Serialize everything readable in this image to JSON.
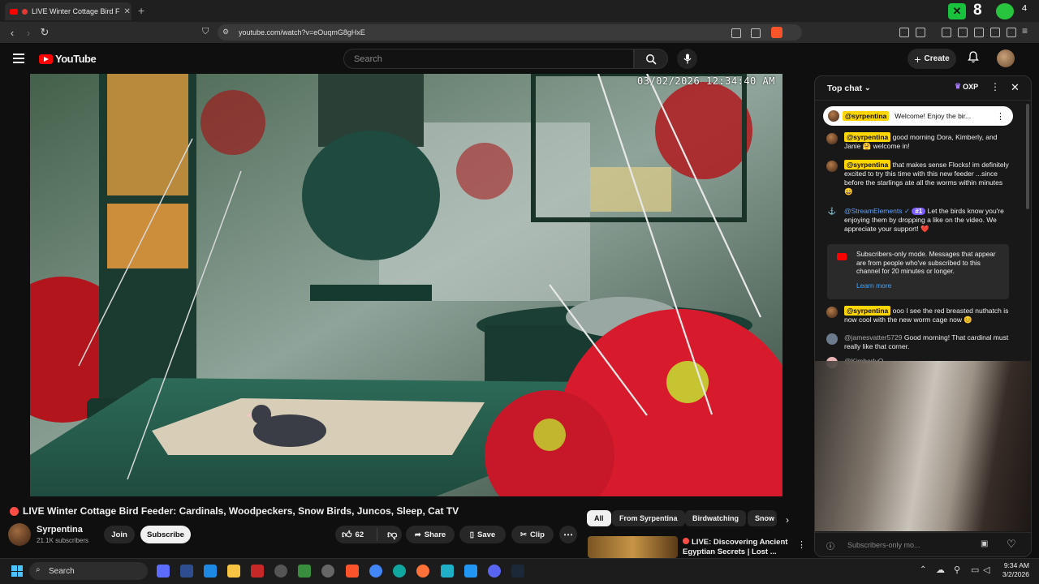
{
  "browser": {
    "tab_title": "LIVE Winter Cottage Bird F",
    "url": "youtube.com/watch?v=eOuqmG8gHxE",
    "ext_badge_count": "8"
  },
  "youtube": {
    "logo_text": "YouTube",
    "search_placeholder": "Search",
    "create_label": "Create"
  },
  "video": {
    "overlay_timestamp": "03/02/2026 12:34:40 AM",
    "title": "LIVE Winter Cottage Bird Feeder: Cardinals, Woodpeckers, Snow Birds, Juncos, Sleep, Cat TV",
    "channel_name": "Syrpentina",
    "subscribers": "21.1K subscribers",
    "join_label": "Join",
    "subscribe_label": "Subscribe",
    "like_count": "62",
    "share_label": "Share",
    "save_label": "Save",
    "clip_label": "Clip"
  },
  "chips": [
    "All",
    "From Syrpentina",
    "Birdwatching",
    "Snow"
  ],
  "related": {
    "title": "LIVE: Discovering Ancient Egyptian Secrets | Lost ..."
  },
  "chat": {
    "header": "Top chat",
    "oxp": "OXP",
    "pinned": {
      "author": "@syrpentina",
      "text": "Welcome! Enjoy the bir..."
    },
    "messages": [
      {
        "author": "@syrpentina",
        "text": "good morning Dora, Kimberly, and Janie 🤗 welcome in!"
      },
      {
        "author": "@syrpentina",
        "text": "that makes sense Flocks! im definitely excited to try this time with this new feeder ...since before the starlings ate all the worms within minutes 😄"
      },
      {
        "author": "@StreamElements",
        "badge": "#1",
        "text": "Let the birds know you're enjoying them by dropping a like on the video. We appreciate your support! ❤️"
      },
      {
        "author": "@syrpentina",
        "text": "ooo I see the red breasted nuthatch is now cool with the new worm cage now 😊"
      },
      {
        "author": "@jamesvatter5729",
        "text": "Good morning! That cardinal must really like that corner."
      },
      {
        "author": "@KimberlyO...",
        "text": ""
      }
    ],
    "notice": {
      "text": "Subscribers-only mode. Messages that appear are from people who've subscribed to this channel for 20 minutes or longer.",
      "link": "Learn more"
    },
    "input_placeholder": "Subscribers-only mo..."
  },
  "taskbar": {
    "search_label": "Search",
    "time": "9:34 AM",
    "date": "3/2/2026"
  },
  "colors": {
    "youtube_red": "#ff0000",
    "chat_highlight": "#ffd600",
    "link_blue": "#3ea6ff"
  }
}
